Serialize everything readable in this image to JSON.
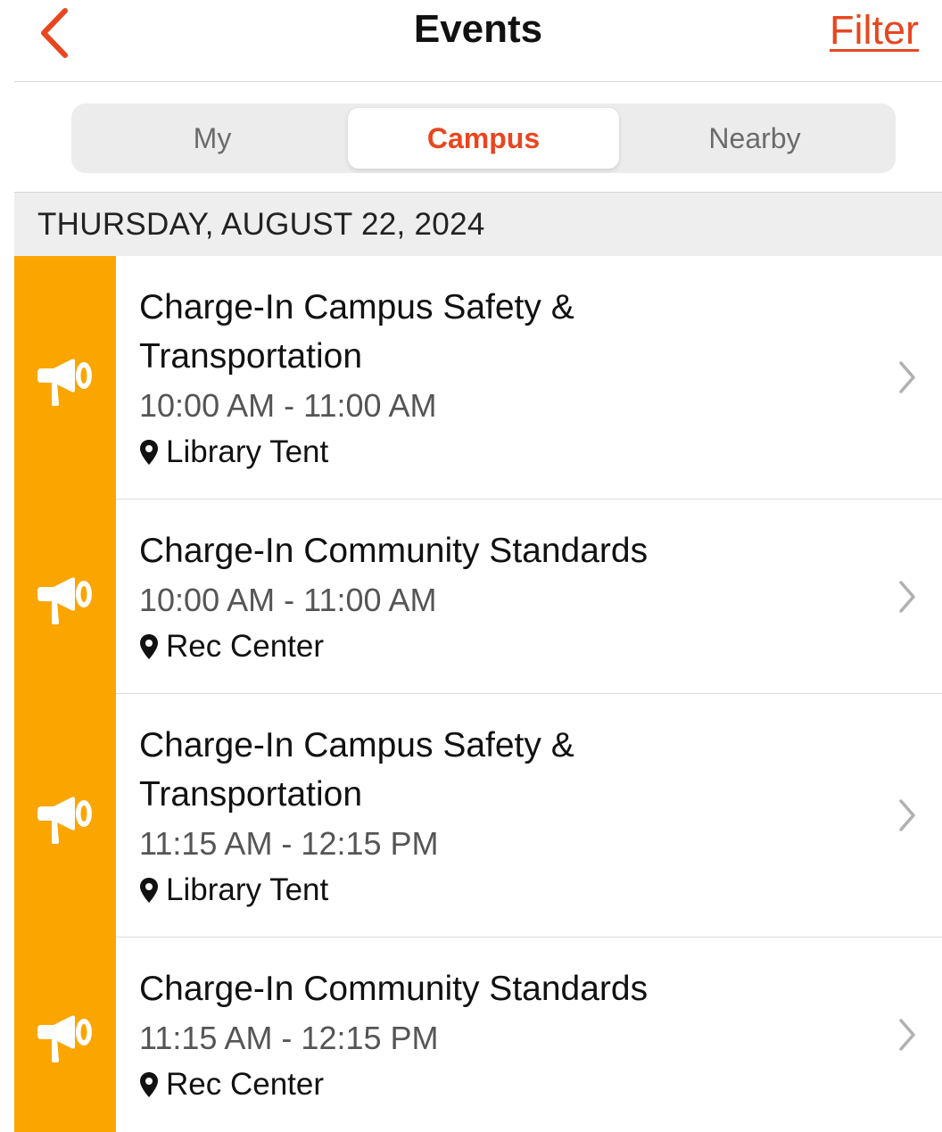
{
  "nav": {
    "title": "Events",
    "filter_label": "Filter",
    "back_icon": "chevron-left-icon",
    "accent_color": "#e8461f"
  },
  "segments": {
    "items": [
      {
        "label": "My",
        "active": false
      },
      {
        "label": "Campus",
        "active": true
      },
      {
        "label": "Nearby",
        "active": false
      }
    ]
  },
  "date_header": "THURSDAY, AUGUST 22, 2024",
  "events": [
    {
      "title": "Charge-In Campus Safety & Transportation",
      "time": "10:00 AM - 11:00 AM",
      "location": "Library Tent",
      "icon": "megaphone-icon"
    },
    {
      "title": "Charge-In Community Standards",
      "time": "10:00 AM - 11:00 AM",
      "location": "Rec Center",
      "icon": "megaphone-icon"
    },
    {
      "title": "Charge-In Campus Safety & Transportation",
      "time": "11:15 AM - 12:15 PM",
      "location": "Library Tent",
      "icon": "megaphone-icon"
    },
    {
      "title": "Charge-In Community Standards",
      "time": "11:15 AM - 12:15 PM",
      "location": "Rec Center",
      "icon": "megaphone-icon"
    }
  ],
  "colors": {
    "event_strip": "#fba500",
    "accent": "#e8461f"
  }
}
